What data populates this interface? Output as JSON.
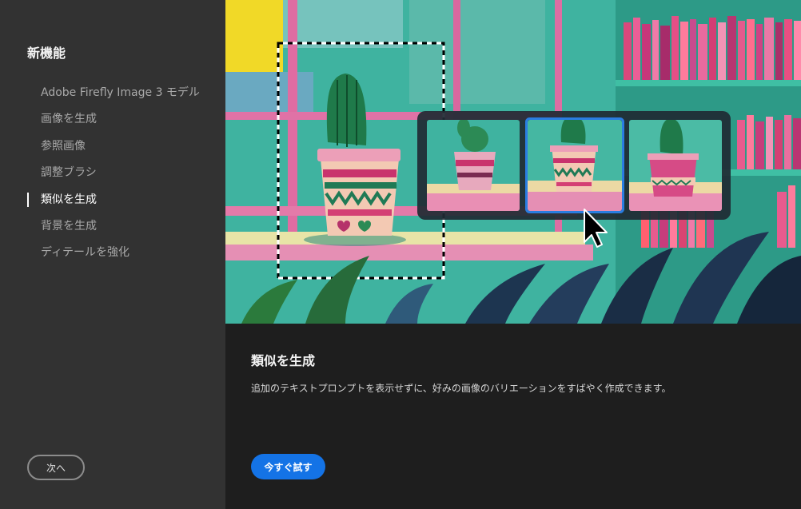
{
  "sidebar": {
    "title": "新機能",
    "items": [
      {
        "label": "Adobe Firefly Image 3 モデル",
        "active": false
      },
      {
        "label": "画像を生成",
        "active": false
      },
      {
        "label": "参照画像",
        "active": false
      },
      {
        "label": "調整ブラシ",
        "active": false
      },
      {
        "label": "類似を生成",
        "active": true
      },
      {
        "label": "背景を生成",
        "active": false
      },
      {
        "label": "ディテールを強化",
        "active": false
      }
    ],
    "next_label": "次へ"
  },
  "hero": {
    "description": "cactus-pot-variations-illustration"
  },
  "main": {
    "title": "類似を生成",
    "description": "追加のテキストプロンプトを表示せずに、好みの画像のバリエーションをすばやく作成できます。",
    "try_label": "今すぐ試す"
  },
  "colors": {
    "accent": "#1473e6",
    "sidebar_bg": "#323232",
    "panel_bg": "#1e1e1e"
  }
}
